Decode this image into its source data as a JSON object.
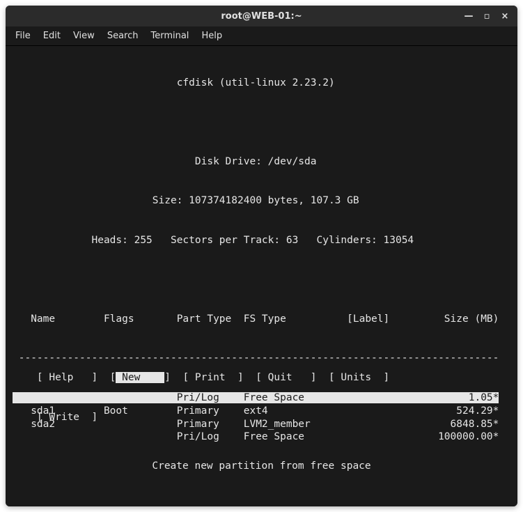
{
  "titlebar": {
    "title": "root@WEB-01:~",
    "min": "—",
    "max": "▫",
    "close": "×"
  },
  "menubar": {
    "file": "File",
    "edit": "Edit",
    "view": "View",
    "search": "Search",
    "terminal": "Terminal",
    "help": "Help"
  },
  "header": {
    "appline": "cfdisk (util-linux 2.23.2)",
    "drive": "Disk Drive: /dev/sda",
    "size": "Size: 107374182400 bytes, 107.3 GB",
    "geom": "Heads: 255   Sectors per Track: 63   Cylinders: 13054"
  },
  "cols": {
    "name": "Name",
    "flags": "Flags",
    "ptype": "Part Type",
    "fstype": "FS Type",
    "label": "[Label]",
    "size": "Size (MB)"
  },
  "rows": [
    {
      "name": "",
      "flags": "",
      "ptype": "Pri/Log",
      "fstype": "Free Space",
      "size": "1.05*",
      "selected": true
    },
    {
      "name": "sda1",
      "flags": "Boot",
      "ptype": "Primary",
      "fstype": "ext4",
      "size": "524.29*",
      "selected": false
    },
    {
      "name": "sda2",
      "flags": "",
      "ptype": "Primary",
      "fstype": "LVM2_member",
      "size": "6848.85*",
      "selected": false
    },
    {
      "name": "",
      "flags": "",
      "ptype": "Pri/Log",
      "fstype": "Free Space",
      "size": "100000.00*",
      "selected": false
    }
  ],
  "buttons": {
    "help": "Help",
    "new": "New",
    "print": "Print",
    "quit": "Quit",
    "units": "Units",
    "write": "Write"
  },
  "hint": "Create new partition from free space"
}
